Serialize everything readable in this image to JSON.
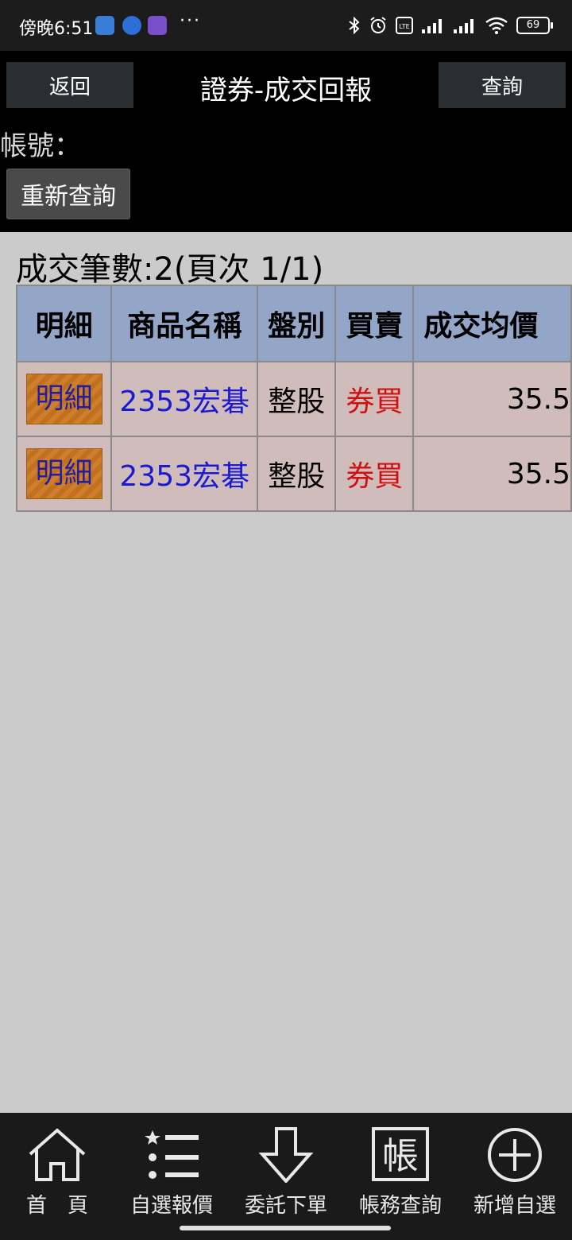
{
  "status_bar": {
    "time": "傍晚6:51",
    "more": "···",
    "battery": "69"
  },
  "header": {
    "back_label": "返回",
    "title": "證券-成交回報",
    "query_label": "查詢",
    "account_label": "帳號：",
    "requery_label": "重新查詢"
  },
  "summary": {
    "count_text": "成交筆數:2(頁次 1/1)"
  },
  "table": {
    "columns": [
      "明細",
      "商品名稱",
      "盤別",
      "買賣",
      "成交均價"
    ],
    "rows": [
      {
        "detail": "明細",
        "product": "2353宏碁",
        "session": "整股",
        "side": "券買",
        "avg_price": "35.5"
      },
      {
        "detail": "明細",
        "product": "2353宏碁",
        "session": "整股",
        "side": "券買",
        "avg_price": "35.5"
      }
    ]
  },
  "bottom_nav": {
    "items": [
      {
        "label": "首　頁",
        "icon": "home-icon"
      },
      {
        "label": "自選報價",
        "icon": "watchlist-icon"
      },
      {
        "label": "委託下單",
        "icon": "order-arrow-icon"
      },
      {
        "label": "帳務查詢",
        "icon": "account-icon",
        "glyph": "帳"
      },
      {
        "label": "新增自選",
        "icon": "add-circle-icon"
      }
    ]
  },
  "colors": {
    "header_bg": "#000000",
    "table_header_bg": "#94a6c8",
    "row_bg": "#d1bcbc",
    "product_text": "#1a1ad0",
    "side_text": "#d01010",
    "detail_button": "#cf7f2b"
  }
}
